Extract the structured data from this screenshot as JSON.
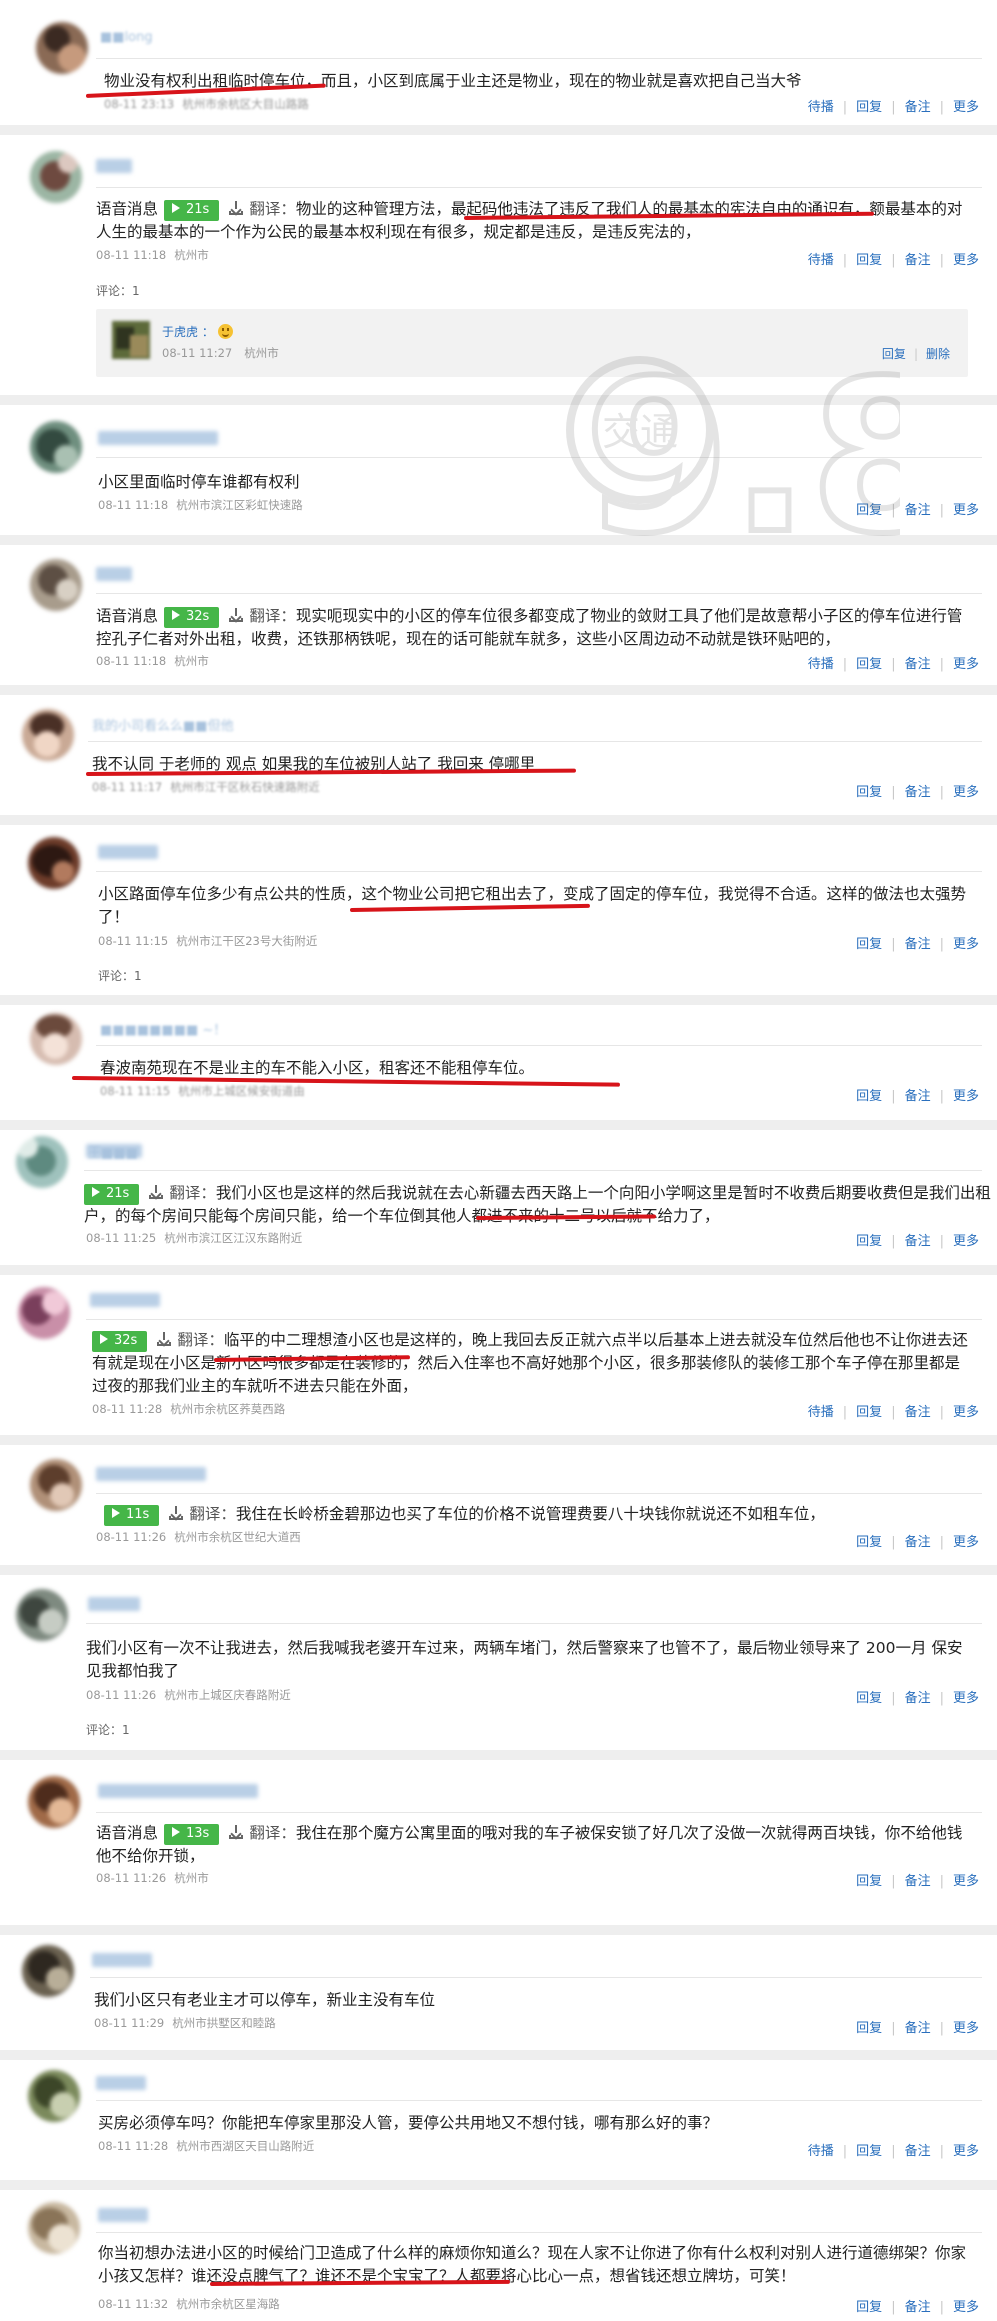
{
  "actions": {
    "play": "待播",
    "reply": "回复",
    "note": "备注",
    "more": "更多",
    "delete": "删除"
  },
  "labels": {
    "voice": "语音消息",
    "translate": "翻译："
  },
  "watermark": {
    "text": "交通",
    "number": "9.8"
  },
  "items": [
    {
      "username": "■■long",
      "text": "物业没有权利出租临时停车位，而且，小区到底属于业主还是物业，现在的物业就是喜欢把自己当大爷",
      "time": "08-11 23:13",
      "location": "杭州市余杭区大目山路路"
    },
    {
      "voice_duration": "21s",
      "text": "物业的这种管理方法，最起码他违法了违反了我们人的最基本的宪法自由的通识有，额最基本的对人生的最基本的一个作为公民的最基本权利现在有很多，规定都是违反，是违反宪法的，",
      "time": "08-11 11:18",
      "location": "杭州市",
      "comments": "评论：1",
      "reply": {
        "user": "于虎虎 ：",
        "time": "08-11 11:27",
        "location": "杭州市"
      }
    },
    {
      "text": "小区里面临时停车谁都有权利",
      "time": "08-11 11:18",
      "location": "杭州市滨江区彩虹快速路"
    },
    {
      "voice_duration": "32s",
      "text": "现实呃现实中的小区的停车位很多都变成了物业的敛财工具了他们是故意帮小子区的停车位进行管控孔子仁者对外出租，收费，还铁那柄铁呢，现在的话可能就车就多，这些小区周边动不动就是铁环贴吧的，",
      "time": "08-11 11:18",
      "location": "杭州市"
    },
    {
      "username": "我的小司看么么■■但他",
      "text": "我不认同 于老师的 观点 如果我的车位被别人站了 我回来 停哪里",
      "time": "08-11 11:17",
      "location": "杭州市江干区秋石快速路附近"
    },
    {
      "text": "小区路面停车位多少有点公共的性质，这个物业公司把它租出去了，变成了固定的停车位，我觉得不合适。这样的做法也太强势了！",
      "time": "08-11 11:15",
      "location": "杭州市江干区23号大街附近",
      "comments": "评论：1"
    },
    {
      "username": "■■■■■■■■ ~！",
      "text": "春波南苑现在不是业主的车不能入小区，租客还不能租停车位。",
      "time": "08-11 11:15",
      "location": "杭州市上城区候安街道由"
    },
    {
      "username": "王■■■",
      "voice_duration": "21s",
      "text": "我们小区也是这样的然后我说就在去心新疆去西天路上一个向阳小学啊这里是暂时不收费后期要收费但是我们出租户，的每个房间只能每个房间只能，给一个车位倒其他人都进不来的十二号以后就不给力了，",
      "time": "08-11 11:25",
      "location": "杭州市滨江区江汉东路附近"
    },
    {
      "voice_duration": "32s",
      "text": "临平的中二理想渣小区也是这样的，晚上我回去反正就六点半以后基本上进去就没车位然后他也不让你进去还有就是现在小区是新小区吗很多都是在装修的，然后入住率也不高好她那个小区，很多那装修队的装修工那个车子停在那里都是过夜的那我们业主的车就听不进去只能在外面，",
      "time": "08-11 11:28",
      "location": "杭州市余杭区荞莫西路"
    },
    {
      "voice_duration": "11s",
      "text": "我住在长岭桥金碧那边也买了车位的价格不说管理费要八十块钱你就说还不如租车位，",
      "time": "08-11 11:26",
      "location": "杭州市余杭区世纪大道西"
    },
    {
      "text": "我们小区有一次不让我进去，然后我喊我老婆开车过来，两辆车堵门，然后警察来了也管不了，最后物业领导来了 200一月 保安见我都怕我了",
      "time": "08-11 11:26",
      "location": "杭州市上城区庆春路附近",
      "comments": "评论：1"
    },
    {
      "voice_duration": "13s",
      "text": "我住在那个魔方公寓里面的哦对我的车子被保安锁了好几次了没做一次就得两百块钱，你不给他钱他不给你开锁，",
      "time": "08-11 11:26",
      "location": "杭州市"
    },
    {
      "text": "我们小区只有老业主才可以停车，新业主没有车位",
      "time": "08-11 11:29",
      "location": "杭州市拱墅区和睦路"
    },
    {
      "text": "买房必须停车吗？你能把车停家里那没人管，要停公共用地又不想付钱，哪有那么好的事？",
      "time": "08-11 11:28",
      "location": "杭州市西湖区天目山路附近"
    },
    {
      "text": "你当初想办法进小区的时候给门卫造成了什么样的麻烦你知道么？现在人家不让你进了你有什么权利对别人进行道德绑架？你家小孩又怎样？谁还没点脾气了？谁还不是个宝宝了？人都要将心比心一点，想省钱还想立牌坊，可笑！",
      "time": "08-11 11:32",
      "location": "杭州市余杭区星海路"
    }
  ]
}
